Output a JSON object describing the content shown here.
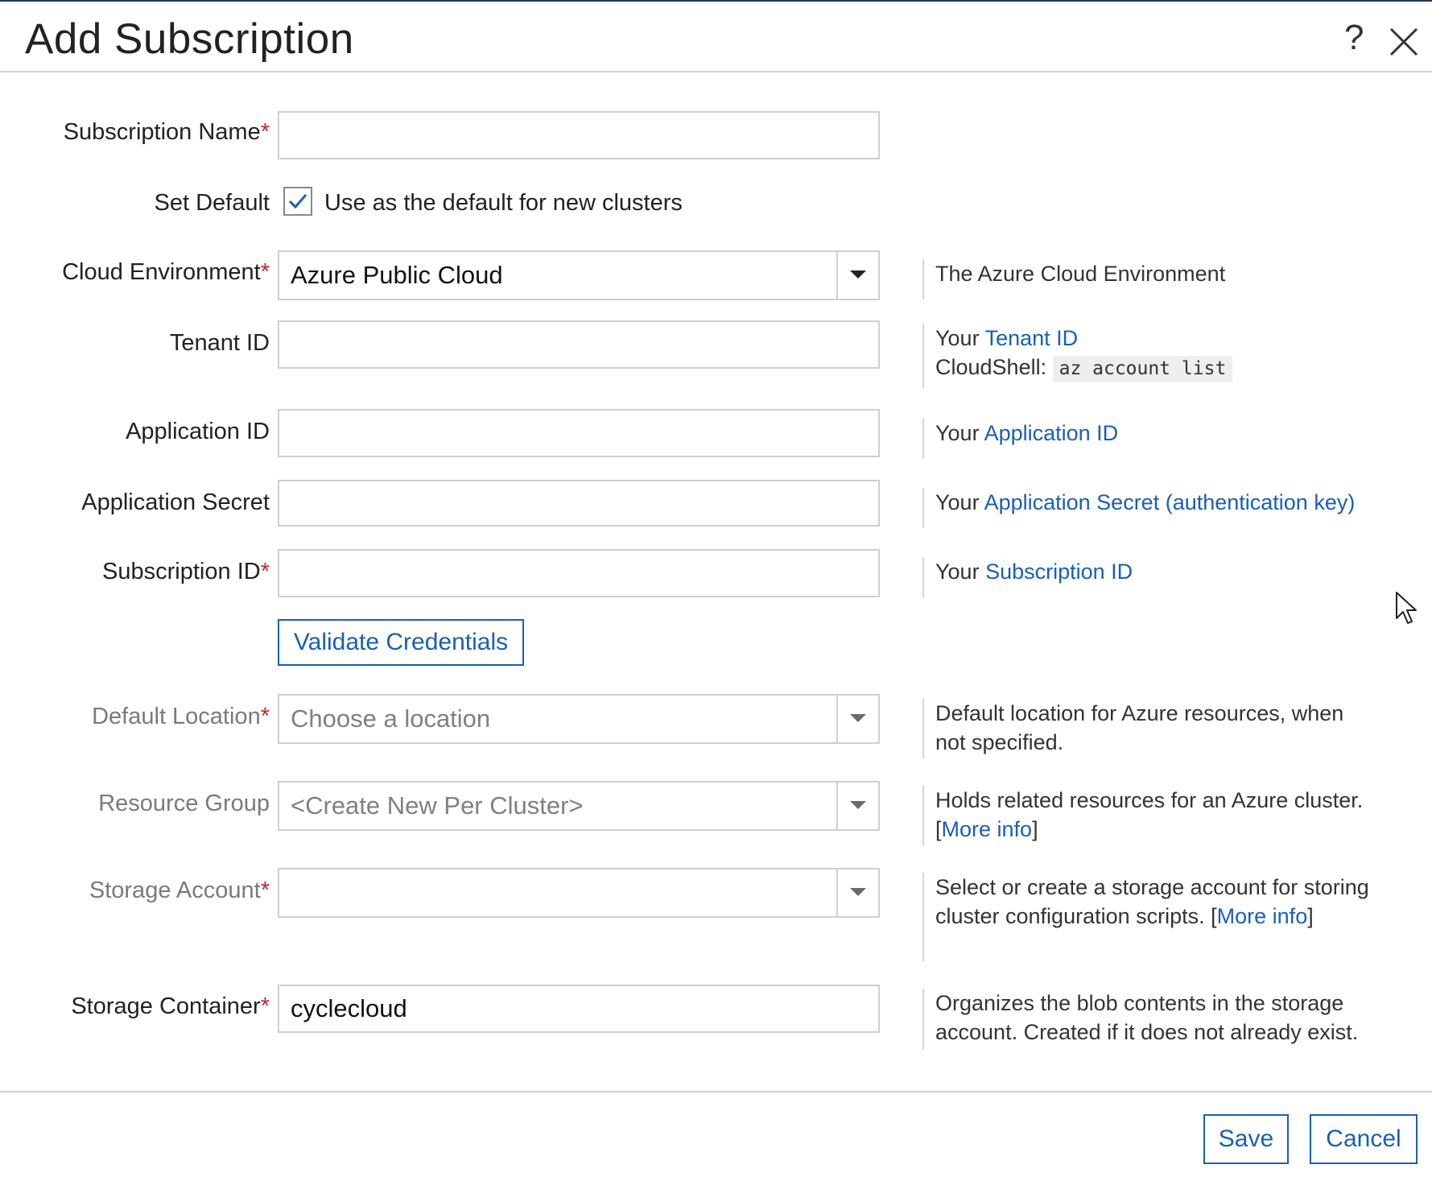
{
  "dialog": {
    "title": "Add Subscription",
    "help_icon": "?"
  },
  "form": {
    "subscription_name": {
      "label": "Subscription Name",
      "required_mark": "*",
      "value": ""
    },
    "set_default": {
      "label": "Set Default",
      "checked": true,
      "checkbox_label": "Use as the default for new clusters"
    },
    "cloud_environment": {
      "label": "Cloud Environment",
      "required_mark": "*",
      "selected": "Azure Public Cloud",
      "help": "The Azure Cloud Environment"
    },
    "tenant_id": {
      "label": "Tenant ID",
      "value": "",
      "help_prefix": "Your ",
      "help_link": "Tenant ID",
      "help_line2_prefix": "CloudShell: ",
      "help_code": "az account list"
    },
    "application_id": {
      "label": "Application ID",
      "value": "",
      "help_prefix": "Your ",
      "help_link": "Application ID"
    },
    "application_secret": {
      "label": "Application Secret",
      "value": "",
      "help_prefix": "Your ",
      "help_link": "Application Secret (authentication key)"
    },
    "subscription_id": {
      "label": "Subscription ID",
      "required_mark": "*",
      "value": "",
      "help_prefix": "Your ",
      "help_link": "Subscription ID"
    },
    "validate_button": "Validate Credentials",
    "default_location": {
      "label": "Default Location",
      "required_mark": "*",
      "placeholder": "Choose a location",
      "help": "Default location for Azure resources, when not specified."
    },
    "resource_group": {
      "label": "Resource Group",
      "selected": "<Create New Per Cluster>",
      "help_text": "Holds related resources for an Azure cluster.",
      "help_open": "[",
      "help_link": "More info",
      "help_close": "]"
    },
    "storage_account": {
      "label": "Storage Account",
      "required_mark": "*",
      "selected": "",
      "help_text": "Select or create a storage account for storing cluster configuration scripts. [",
      "help_link": "More info",
      "help_close": "]"
    },
    "storage_container": {
      "label": "Storage Container",
      "required_mark": "*",
      "value": "cyclecloud",
      "help": "Organizes the blob contents in the storage account. Created if it does not already exist."
    }
  },
  "footer": {
    "save_label": "Save",
    "cancel_label": "Cancel"
  },
  "colors": {
    "accent": "#1a5fb4",
    "required": "#c4262e"
  },
  "icons": [
    "help-icon",
    "close-icon",
    "check-icon",
    "chevron-down-icon",
    "mouse-cursor-icon"
  ]
}
